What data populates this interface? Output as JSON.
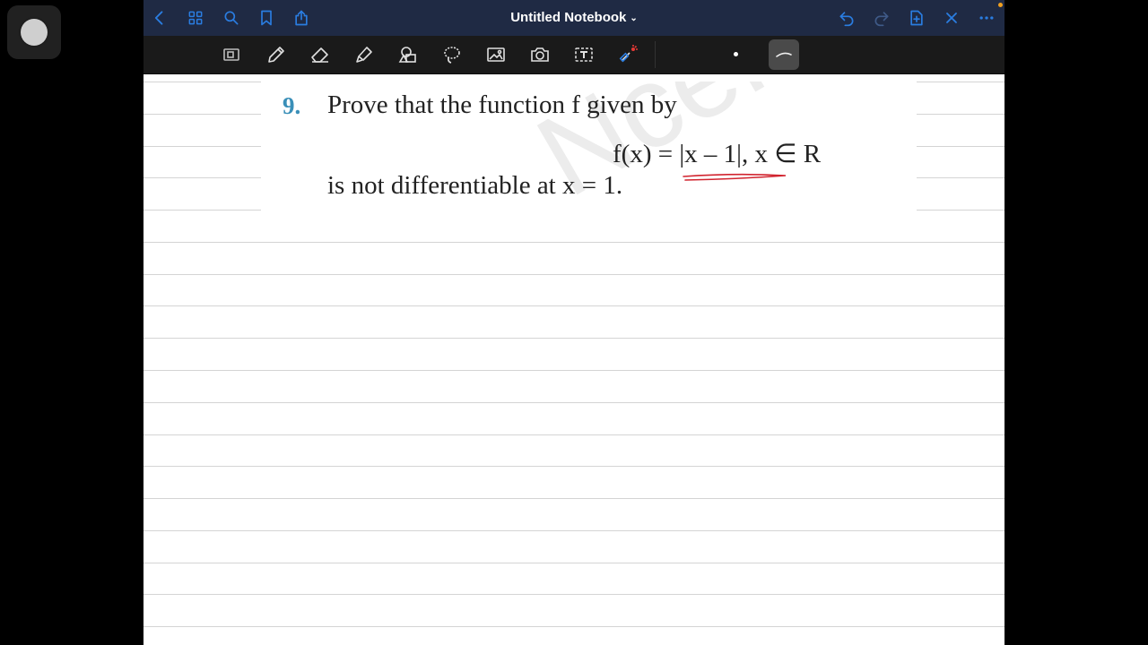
{
  "header": {
    "title": "Untitled Notebook",
    "title_chevron": "⌄"
  },
  "icons": {
    "top_left": [
      "back-icon",
      "thumbnails-icon",
      "search-icon",
      "bookmark-icon",
      "share-icon"
    ],
    "top_right": [
      "undo-icon",
      "redo-icon",
      "add-page-icon",
      "close-icon",
      "more-icon"
    ],
    "tools": [
      "reader-icon",
      "pen-icon",
      "eraser-icon",
      "highlighter-icon",
      "shapes-icon",
      "lasso-icon",
      "image-icon",
      "camera-icon",
      "text-icon",
      "laser-pointer-icon"
    ]
  },
  "colors": {
    "accent": "#2a7de1",
    "topbar": "#1f2a44",
    "toolbar": "#1a1a1a",
    "ink": "#d1242f",
    "question_number": "#3a8fb8"
  },
  "note": {
    "question_number": "9.",
    "line1": "Prove that the function f given by",
    "equation": "f(x) = |x – 1|, x ∈ R",
    "line3": "is not differentiable at x = 1."
  }
}
